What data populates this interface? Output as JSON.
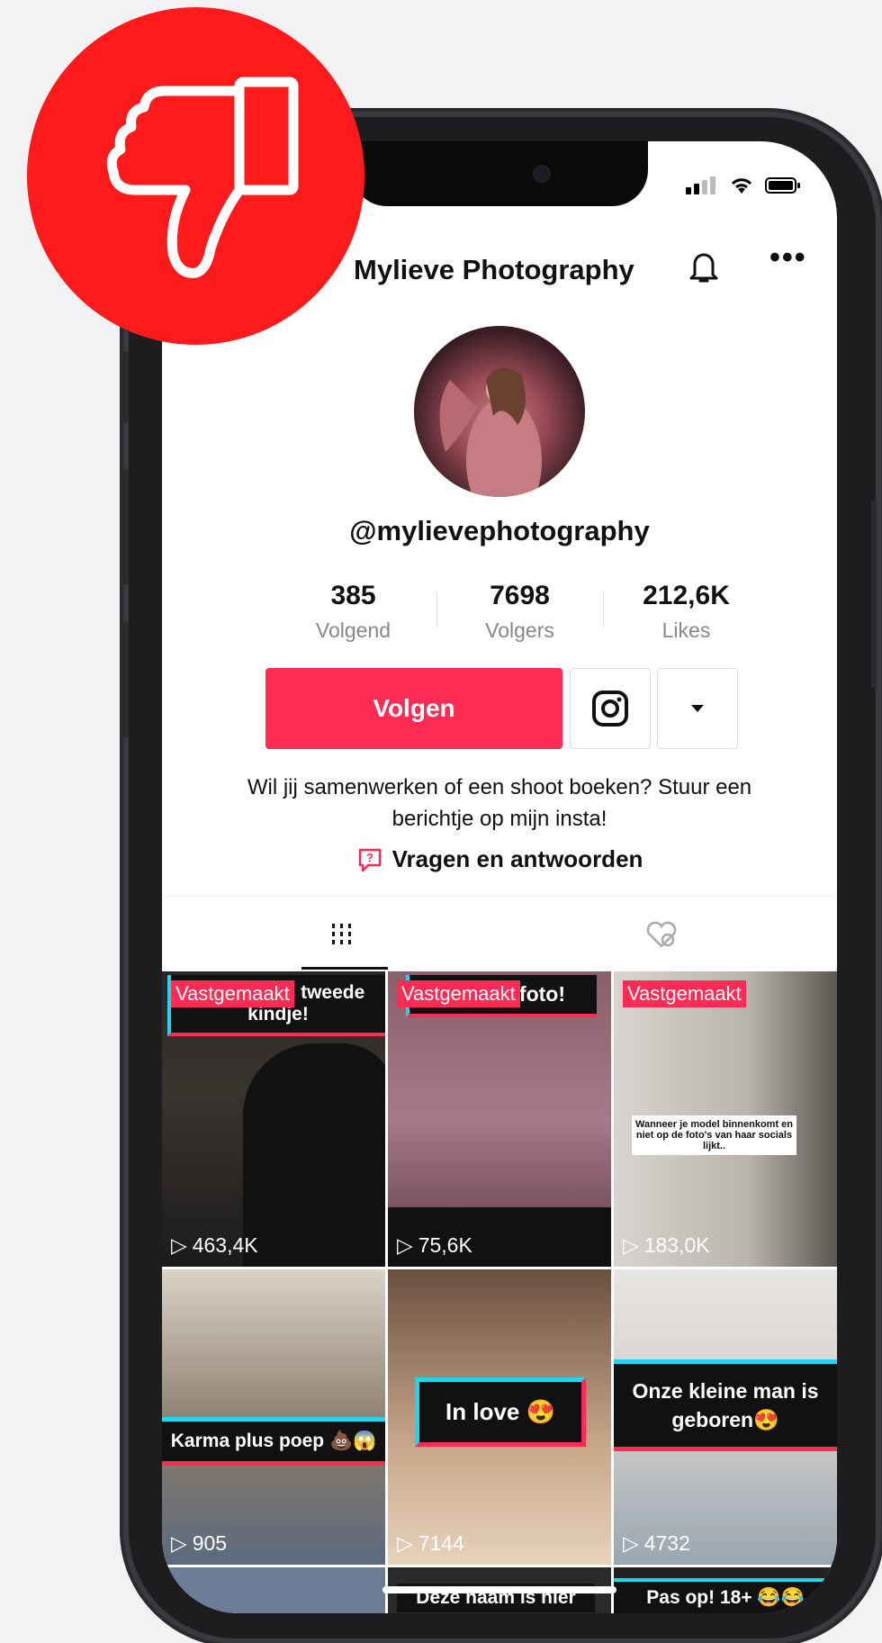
{
  "profile": {
    "name": "Mylieve Photography",
    "handle": "@mylievephotography",
    "stats": [
      {
        "value": "385",
        "label": "Volgend"
      },
      {
        "value": "7698",
        "label": "Volgers"
      },
      {
        "value": "212,6K",
        "label": "Likes"
      }
    ],
    "follow_label": "Volgen",
    "bio": "Wil jij samenwerken of een shoot boeken? Stuur een berichtje op mijn insta!",
    "qa_label": "Vragen en antwoorden"
  },
  "pinned_label": "Vastgemaakt",
  "videos": [
    {
      "caption": "...n van ons tweede kindje!",
      "views": "463,4K",
      "pinned": true
    },
    {
      "caption": "Nieuwe foto!",
      "views": "75,6K",
      "pinned": true
    },
    {
      "caption": "Wanneer je model binnenkomt en niet op de foto's van haar socials lijkt..",
      "views": "183,0K",
      "pinned": true
    },
    {
      "caption": "Karma plus poep 💩😱",
      "views": "905",
      "pinned": false
    },
    {
      "caption": "In love 😍",
      "views": "7144",
      "pinned": false
    },
    {
      "caption": "Onze kleine man is geboren😍",
      "views": "4732",
      "pinned": false
    },
    {
      "caption": "Deze naam is hier",
      "views": "",
      "pinned": false
    },
    {
      "caption": "Pas op! 18+ 😂😂",
      "views": "",
      "pinned": false
    }
  ],
  "colors": {
    "accent": "#fe2c55",
    "badge": "#ff1b1b",
    "caption_border_cyan": "#20d5ec"
  },
  "icons": [
    "thumbs-down-icon",
    "bell-icon",
    "more-icon",
    "instagram-icon",
    "dropdown-icon",
    "qa-icon",
    "grid-icon",
    "liked-hidden-icon",
    "play-icon"
  ]
}
